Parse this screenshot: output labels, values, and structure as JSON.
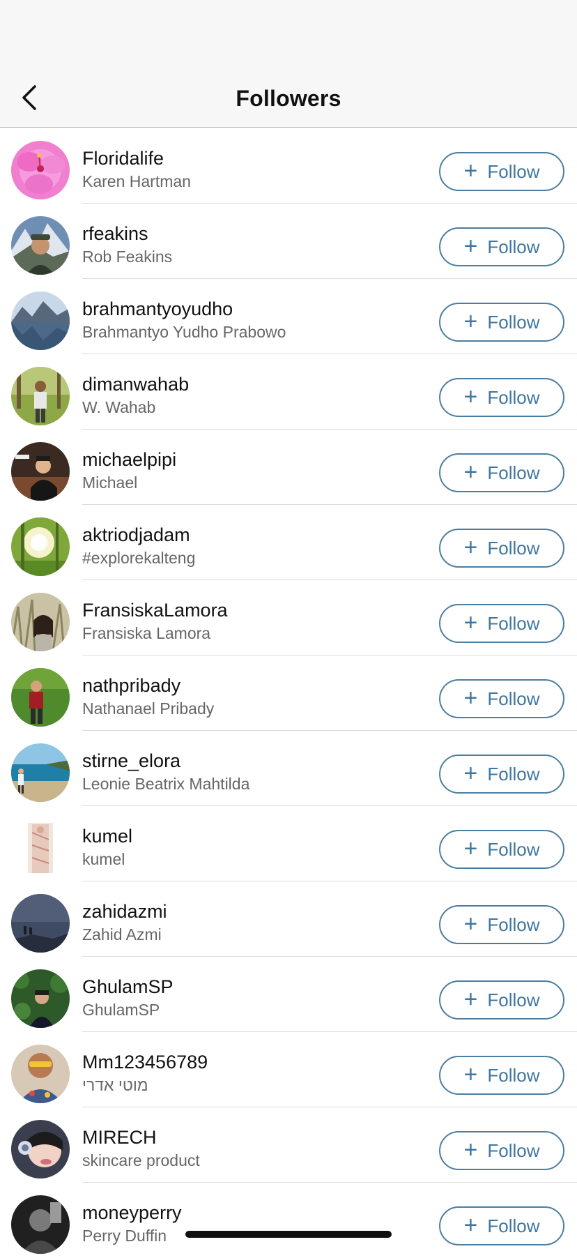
{
  "header": {
    "title": "Followers",
    "back_icon": "chevron-left-icon"
  },
  "colors": {
    "accent": "#3f76a0",
    "header_bg": "#f7f7f7",
    "secondary_text": "#666666"
  },
  "followers": [
    {
      "username": "Floridalife",
      "full_name": "Karen Hartman",
      "button": "Follow"
    },
    {
      "username": "rfeakins",
      "full_name": "Rob Feakins",
      "button": "Follow"
    },
    {
      "username": "brahmantyoyudho",
      "full_name": "Brahmantyo Yudho Prabowo",
      "button": "Follow"
    },
    {
      "username": "dimanwahab",
      "full_name": "W. Wahab",
      "button": "Follow"
    },
    {
      "username": "michaelpipi",
      "full_name": "Michael",
      "button": "Follow"
    },
    {
      "username": "aktriodjadam",
      "full_name": "#explorekalteng",
      "button": "Follow"
    },
    {
      "username": "FransiskaLamora",
      "full_name": "Fransiska Lamora",
      "button": "Follow"
    },
    {
      "username": "nathpribady",
      "full_name": "Nathanael Pribady",
      "button": "Follow"
    },
    {
      "username": "stirne_elora",
      "full_name": "Leonie Beatrix Mahtilda",
      "button": "Follow"
    },
    {
      "username": "kumel",
      "full_name": "kumel",
      "button": "Follow"
    },
    {
      "username": "zahidazmi",
      "full_name": "Zahid Azmi",
      "button": "Follow"
    },
    {
      "username": "GhulamSP",
      "full_name": "GhulamSP",
      "button": "Follow"
    },
    {
      "username": "Mm123456789",
      "full_name": "מוטי אדרי",
      "button": "Follow"
    },
    {
      "username": "MIRECH",
      "full_name": "skincare product",
      "button": "Follow"
    },
    {
      "username": "moneyperry",
      "full_name": "Perry Duffin",
      "button": "Follow"
    }
  ]
}
